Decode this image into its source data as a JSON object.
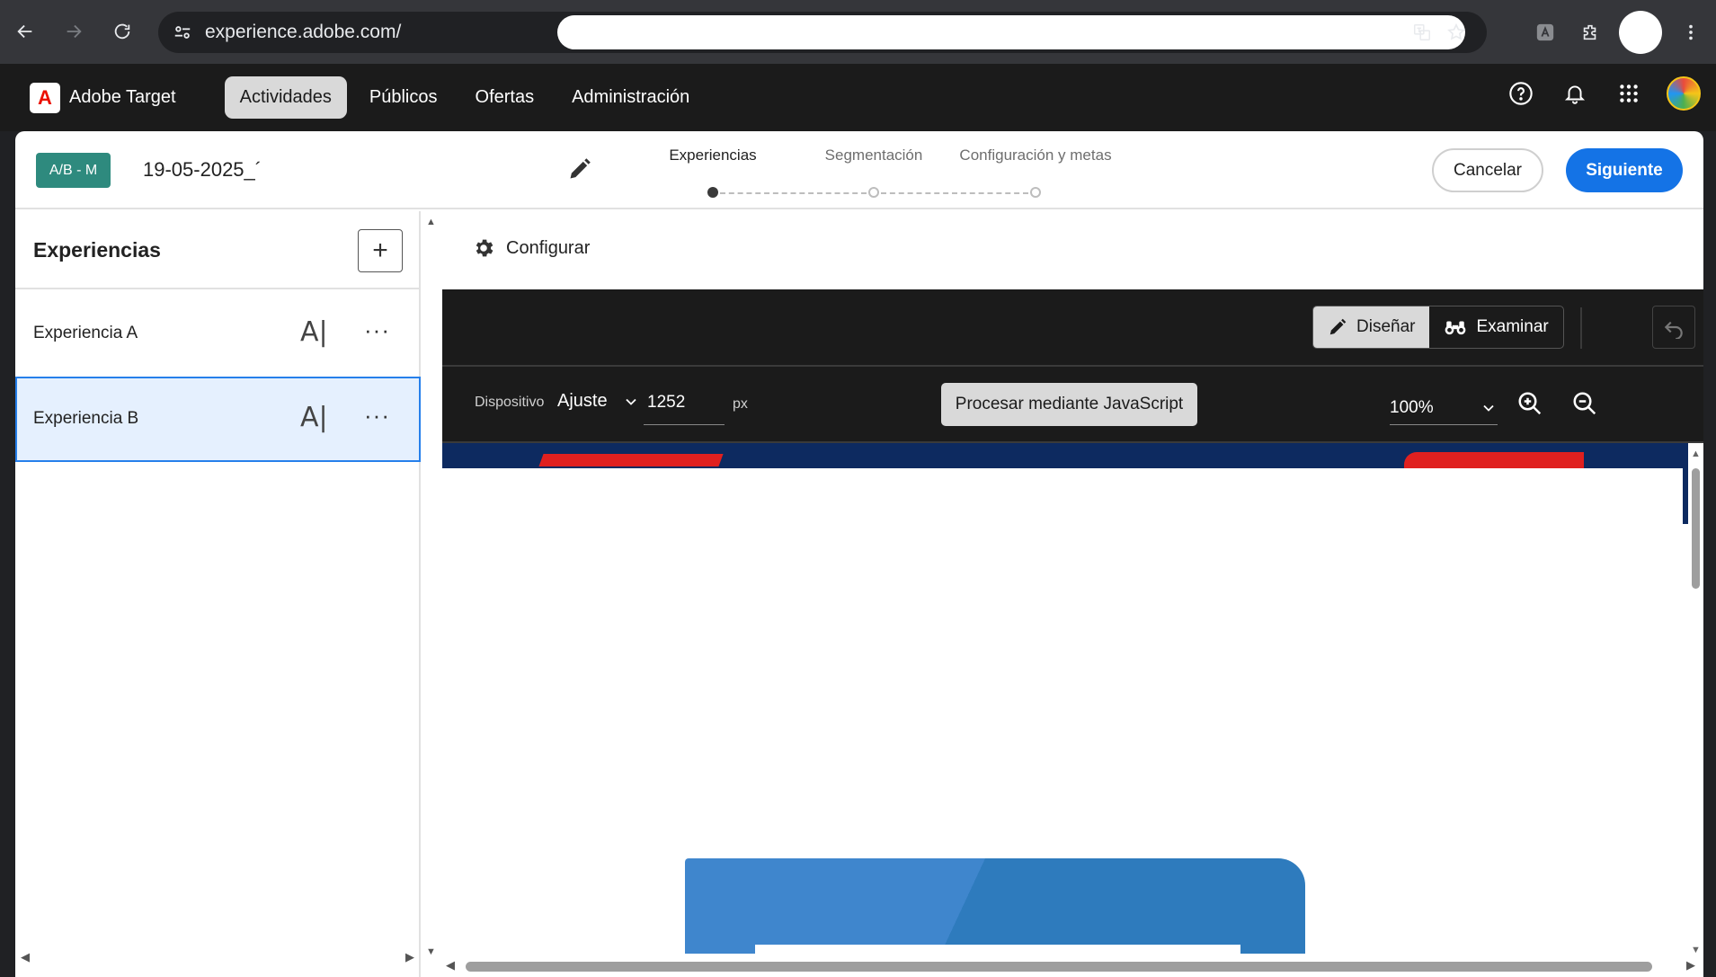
{
  "browser": {
    "url": "experience.adobe.com/"
  },
  "app": {
    "name": "Adobe Target",
    "logo_letter": "A",
    "nav": [
      {
        "label": "Actividades",
        "active": true
      },
      {
        "label": "Públicos",
        "active": false
      },
      {
        "label": "Ofertas",
        "active": false
      },
      {
        "label": "Administración",
        "active": false
      }
    ]
  },
  "activity": {
    "badge": "A/B - M",
    "name": "19-05-2025_´",
    "steps": [
      {
        "label": "Experiencias",
        "state": "current"
      },
      {
        "label": "Segmentación",
        "state": "pending"
      },
      {
        "label": "Configuración y metas",
        "state": "pending"
      }
    ],
    "cancel_label": "Cancelar",
    "next_label": "Siguiente"
  },
  "experiences": {
    "title": "Experiencias",
    "add_label": "+",
    "items": [
      {
        "label": "Experiencia A",
        "selected": false,
        "ai_label": "A|",
        "more_label": "···"
      },
      {
        "label": "Experiencia B",
        "selected": true,
        "ai_label": "A|",
        "more_label": "···"
      }
    ]
  },
  "editor": {
    "configure_label": "Configurar",
    "mode_design": "Diseñar",
    "mode_browse": "Examinar",
    "device_label": "Dispositivo",
    "device_value": "Ajuste",
    "width_value": "1252",
    "width_unit": "px",
    "render_button": "Procesar mediante JavaScript",
    "zoom_value": "100%"
  },
  "colors": {
    "accent": "#1473e6",
    "badge": "#2e8a7e",
    "selected_bg": "#e5f0fe"
  }
}
